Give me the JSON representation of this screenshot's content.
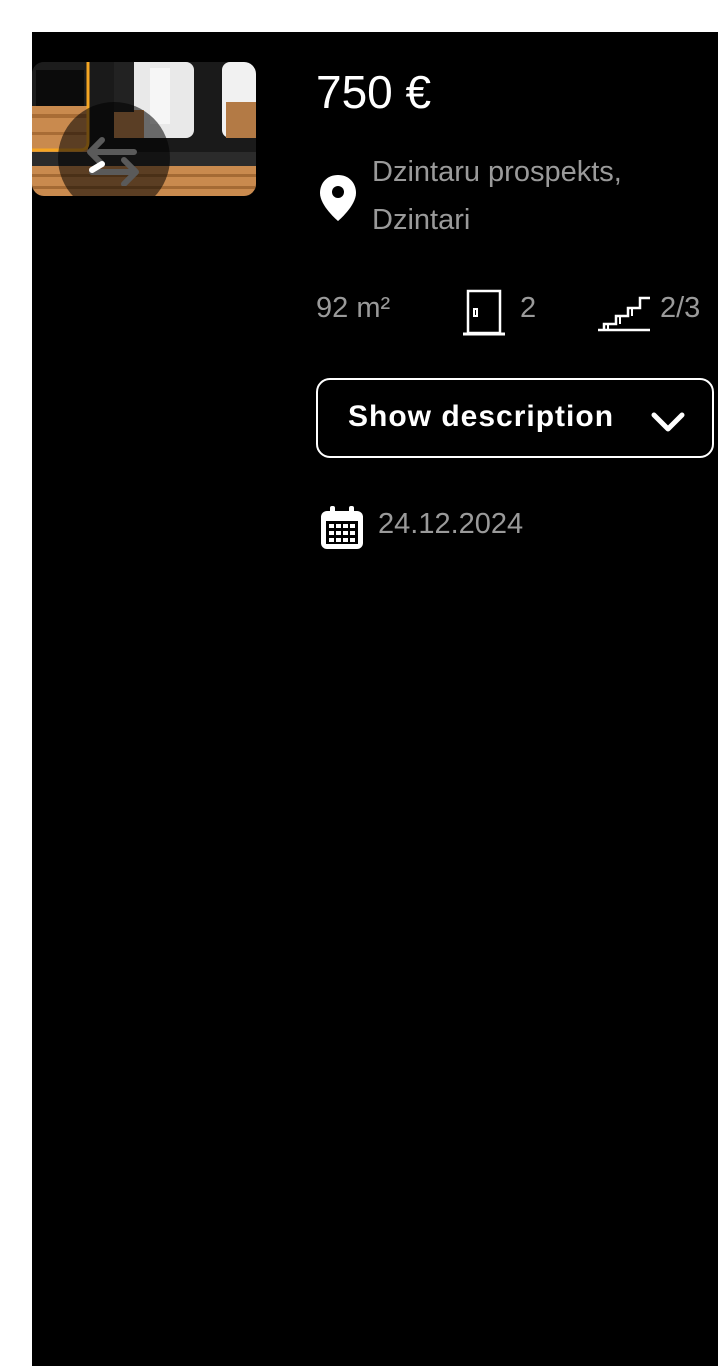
{
  "listing": {
    "price": "750 €",
    "address": "Dzintaru prospekts, Dzintari",
    "area": "92 m²",
    "rooms": "2",
    "floor": "2/3",
    "date": "24.12.2024",
    "show_description_label": "Show description"
  },
  "gallery": {
    "active_border_color": "#f5a623"
  },
  "icons": {
    "location": "map-pin-icon",
    "rooms": "door-icon",
    "floor": "stairs-icon",
    "expand": "chevron-down-icon",
    "date": "calendar-icon",
    "gallery_toggle": "swap-arrows-icon"
  }
}
